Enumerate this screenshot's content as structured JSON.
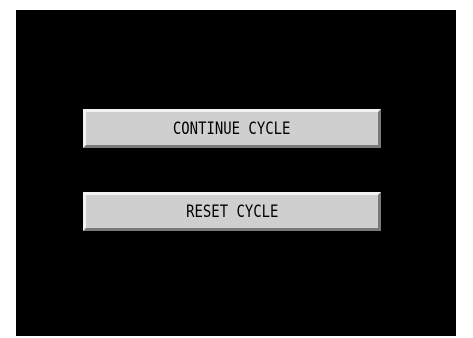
{
  "buttons": {
    "continue_label": "CONTINUE CYCLE",
    "reset_label": "RESET CYCLE"
  },
  "colors": {
    "screen_background": "#000000",
    "button_face": "#cfcfcf",
    "button_text": "#000000"
  }
}
